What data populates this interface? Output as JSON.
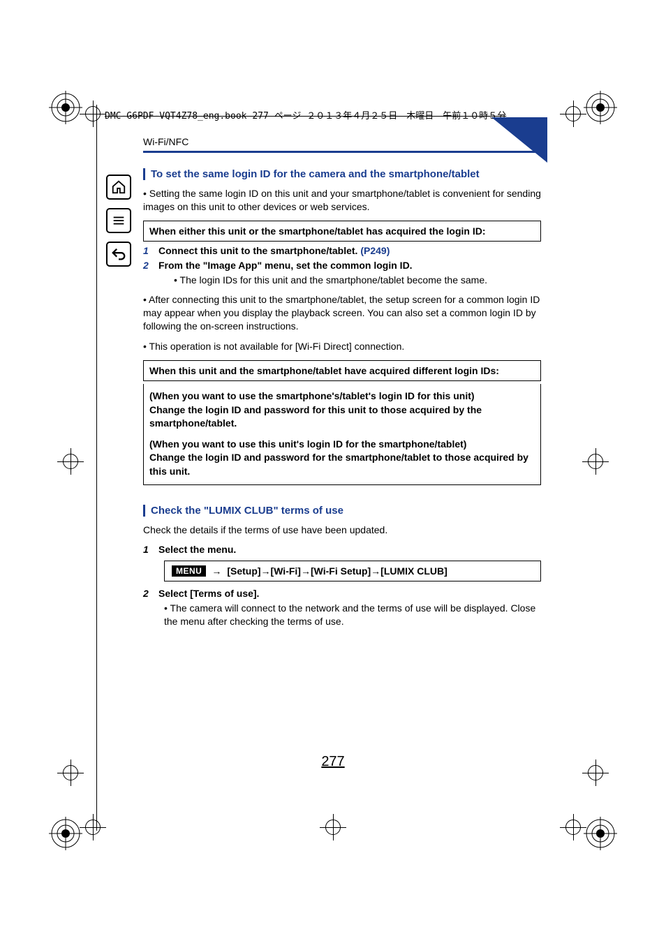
{
  "print_header": "DMC-G6PDF-VQT4Z78_eng.book  277 ページ  ２０１３年４月２５日　木曜日　午前１０時５分",
  "section": "Wi-Fi/NFC",
  "heading1": "To set the same login ID for the camera and the smartphone/tablet",
  "intro1": "• Setting the same login ID on this unit and your smartphone/tablet is convenient for sending images on this unit to other devices or web services.",
  "box1": "When either this unit or the smartphone/tablet has acquired the login ID:",
  "step1_num": "1",
  "step1_text": "Connect this unit to the smartphone/tablet. ",
  "step1_link": "(P249)",
  "step2_num": "2",
  "step2_text": "From the \"Image App\" menu, set the common login ID.",
  "step2_sub": "• The login IDs for this unit and the smartphone/tablet become the same.",
  "note1": "• After connecting this unit to the smartphone/tablet, the setup screen for a common login ID may appear when you display the playback screen. You can also set a common login ID by following the on-screen instructions.",
  "note2": "• This operation is not available for [Wi-Fi Direct] connection.",
  "box2": "When this unit and the smartphone/tablet have acquired different login IDs:",
  "bigbox_p1": "(When you want to use the smartphone's/tablet's login ID for this unit)\nChange the login ID and password for this unit to those acquired by the smartphone/tablet.",
  "bigbox_p2": "(When you want to use this unit's login ID for the smartphone/tablet)\nChange the login ID and password for the smartphone/tablet to those acquired by this unit.",
  "heading2": "Check the \"LUMIX CLUB\" terms of use",
  "intro2": "Check the details if the terms of use have been updated.",
  "stepA_num": "1",
  "stepA_text": "Select the menu.",
  "menu_label": "MENU",
  "menu_path": "[Setup]→[Wi-Fi]→[Wi-Fi Setup]→[LUMIX CLUB]",
  "stepB_num": "2",
  "stepB_text": "Select [Terms of use].",
  "stepB_sub": "• The camera will connect to the network and the terms of use will be displayed. Close the menu after checking the terms of use.",
  "page_number": "277",
  "icons": {
    "home": "home-icon",
    "toc": "list-icon",
    "back": "back-icon"
  }
}
